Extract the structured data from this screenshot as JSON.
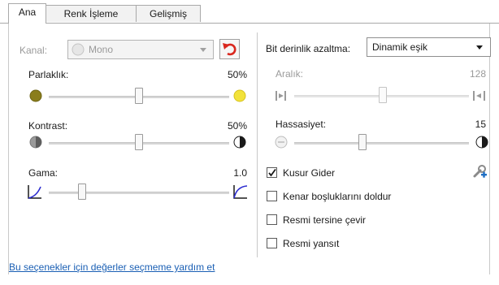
{
  "tabs": [
    {
      "label": "Ana",
      "active": true
    },
    {
      "label": "Renk İşleme",
      "active": false
    },
    {
      "label": "Gelişmiş",
      "active": false
    }
  ],
  "left": {
    "channel": {
      "label": "Kanal:",
      "value": "Mono",
      "enabled": false
    },
    "brightness": {
      "label": "Parlaklık:",
      "value": "50%",
      "level": 0.5
    },
    "contrast": {
      "label": "Kontrast:",
      "value": "50%",
      "level": 0.5
    },
    "gamma": {
      "label": "Gama:",
      "value": "1.0",
      "level": 0.2
    }
  },
  "right": {
    "bit_depth": {
      "label": "Bit derinlik azaltma:",
      "value": "Dinamik eşik"
    },
    "range": {
      "label": "Aralık:",
      "value": "128",
      "enabled": false,
      "level": 0.5
    },
    "sensitivity": {
      "label": "Hassasiyet:",
      "value": "15",
      "level": 0.4
    },
    "checkboxes": [
      {
        "label": "Kusur Gider",
        "checked": true
      },
      {
        "label": "Kenar boşluklarını doldur",
        "checked": false
      },
      {
        "label": "Resmi tersine çevir",
        "checked": false
      },
      {
        "label": "Resmi yansıt",
        "checked": false
      }
    ]
  },
  "help_link": "Bu seçenekler için değerler seçmeme yardım et",
  "colors": {
    "reset_red": "#d9271e",
    "link_blue": "#1a5fb4",
    "brightness_low": "#8a7d1c",
    "brightness_high": "#f2e23a"
  },
  "icons": [
    "reset-undo-icon",
    "brightness-low-icon",
    "brightness-high-icon",
    "contrast-low-icon",
    "contrast-high-icon",
    "gamma-low-icon",
    "gamma-high-icon",
    "range-low-icon",
    "range-high-icon",
    "sensitivity-low-icon",
    "sensitivity-high-icon",
    "despeckle-settings-icon",
    "checkmark-icon"
  ]
}
